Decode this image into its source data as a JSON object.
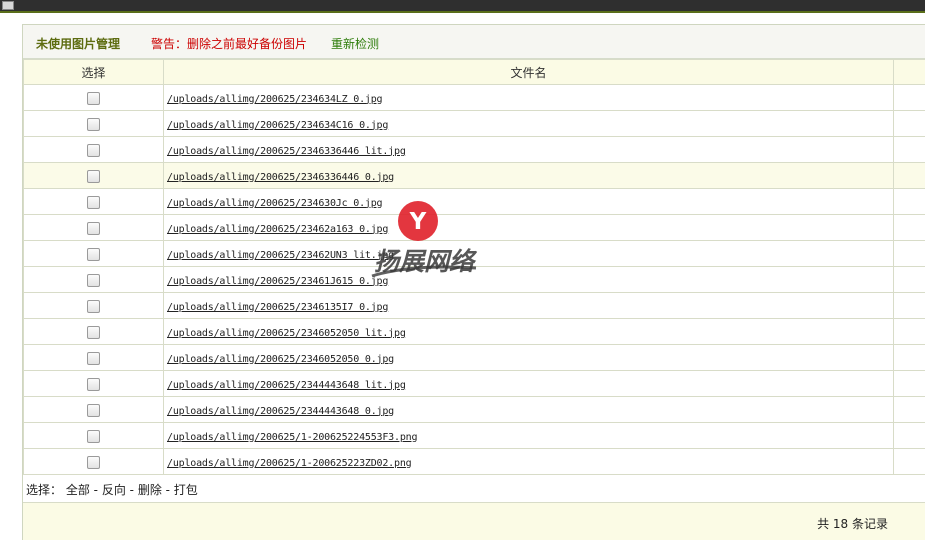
{
  "header": {
    "title": "未使用图片管理",
    "warning": "警告：删除之前最好备份图片",
    "recheck": "重新检测"
  },
  "table": {
    "columns": [
      "选择",
      "文件名"
    ],
    "rows": [
      "/uploads/allimg/200625/234634LZ 0.jpg",
      "/uploads/allimg/200625/234634C16 0.jpg",
      "/uploads/allimg/200625/2346336446 lit.jpg",
      "/uploads/allimg/200625/2346336446 0.jpg",
      "/uploads/allimg/200625/234630Jc 0.jpg",
      "/uploads/allimg/200625/23462a163 0.jpg",
      "/uploads/allimg/200625/23462UN3 lit.jpg",
      "/uploads/allimg/200625/23461J615 0.jpg",
      "/uploads/allimg/200625/2346135I7 0.jpg",
      "/uploads/allimg/200625/2346052050 lit.jpg",
      "/uploads/allimg/200625/2346052050 0.jpg",
      "/uploads/allimg/200625/2344443648 lit.jpg",
      "/uploads/allimg/200625/2344443648 0.jpg",
      "/uploads/allimg/200625/1-200625224553F3.png",
      "/uploads/allimg/200625/1-200625223ZD02.png"
    ],
    "highlighted_row": 3
  },
  "footer": {
    "select_label": "选择：",
    "all": "全部",
    "sep": " - ",
    "invert": "反向",
    "delete": "删除",
    "pack": "打包",
    "total": "共 18 条记录"
  },
  "watermark": {
    "letter": "Y",
    "text": "扬展网络"
  },
  "colors": {
    "title": "#5d6c10",
    "warning": "#cc0000",
    "recheck": "#2e7d0b",
    "header_bg": "#fbfbe5",
    "watermark_red": "#e0202a"
  }
}
